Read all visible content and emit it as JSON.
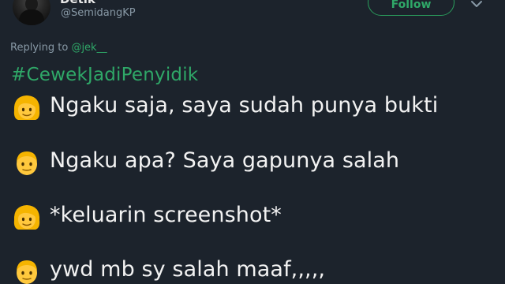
{
  "tweet": {
    "display_name": "Detik",
    "handle": "@SemidangKP",
    "follow_label": "Follow",
    "replying_prefix": "Replying to ",
    "replying_mention": "@jek__",
    "hashtag": "#CewekJadiPenyidik",
    "lines": [
      {
        "emoji": "woman-emoji",
        "text": "Ngaku saja, saya sudah punya bukti"
      },
      {
        "emoji": "man-emoji",
        "text": "Ngaku apa? Saya gapunya salah"
      },
      {
        "emoji": "woman-emoji",
        "text": "*keluarin screenshot*"
      },
      {
        "emoji": "man-emoji",
        "text": "ywd mb sy salah maaf,,,,,"
      }
    ]
  },
  "colors": {
    "background": "#1c232c",
    "accent_green": "#2fa868",
    "muted_gray": "#8899a6",
    "text": "#f2f2f2"
  }
}
